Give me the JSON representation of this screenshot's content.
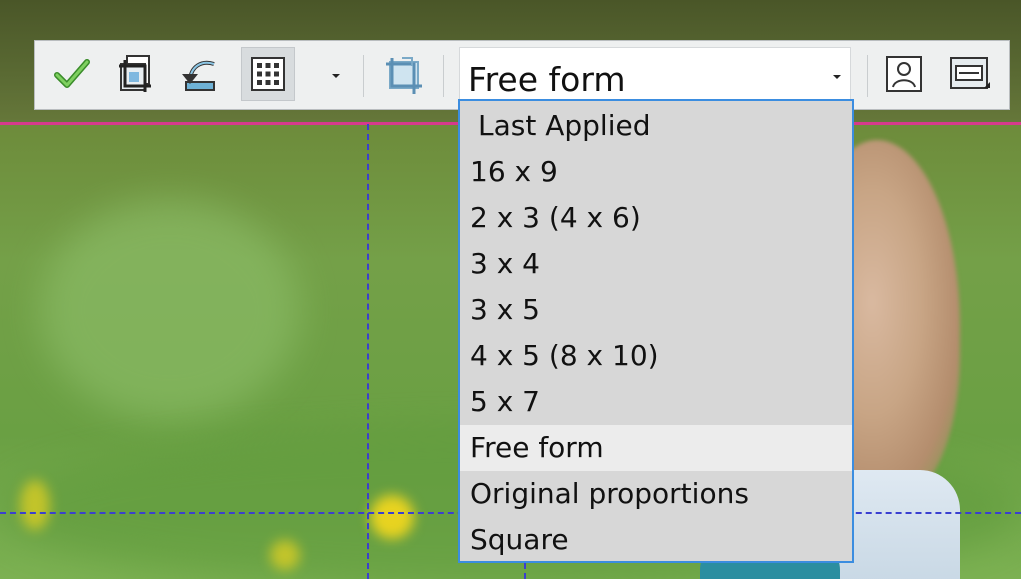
{
  "toolbar": {
    "buttons": [
      {
        "name": "apply-crop-button",
        "icon": "checkmark-icon"
      },
      {
        "name": "crop-to-new-image-button",
        "icon": "crop-document-icon"
      },
      {
        "name": "rotate-crop-button",
        "icon": "rotate-arrow-icon"
      },
      {
        "name": "grid-button",
        "icon": "grid-icon"
      },
      {
        "name": "snap-crop-button",
        "icon": "crop-snap-icon"
      },
      {
        "name": "portrait-button",
        "icon": "portrait-icon"
      },
      {
        "name": "landscape-button",
        "icon": "landscape-icon"
      }
    ],
    "ratio_combo": {
      "value": "Free form"
    }
  },
  "dropdown": {
    "items": [
      "Last Applied",
      "16 x 9",
      "2 x 3 (4 x 6)",
      "3 x 4",
      "3 x 5",
      "4 x 5 (8 x 10)",
      "5 x 7",
      "Free form",
      "Original proportions",
      "Square"
    ],
    "selected_index": 7
  },
  "colors": {
    "toolbar_bg": "#eef0f0",
    "dropdown_bg": "#d7d7d7",
    "dropdown_border": "#3b8de0",
    "selected_bg": "#ececec",
    "guide_line": "#3a3fd0",
    "crop_edge": "#d63a8c"
  }
}
